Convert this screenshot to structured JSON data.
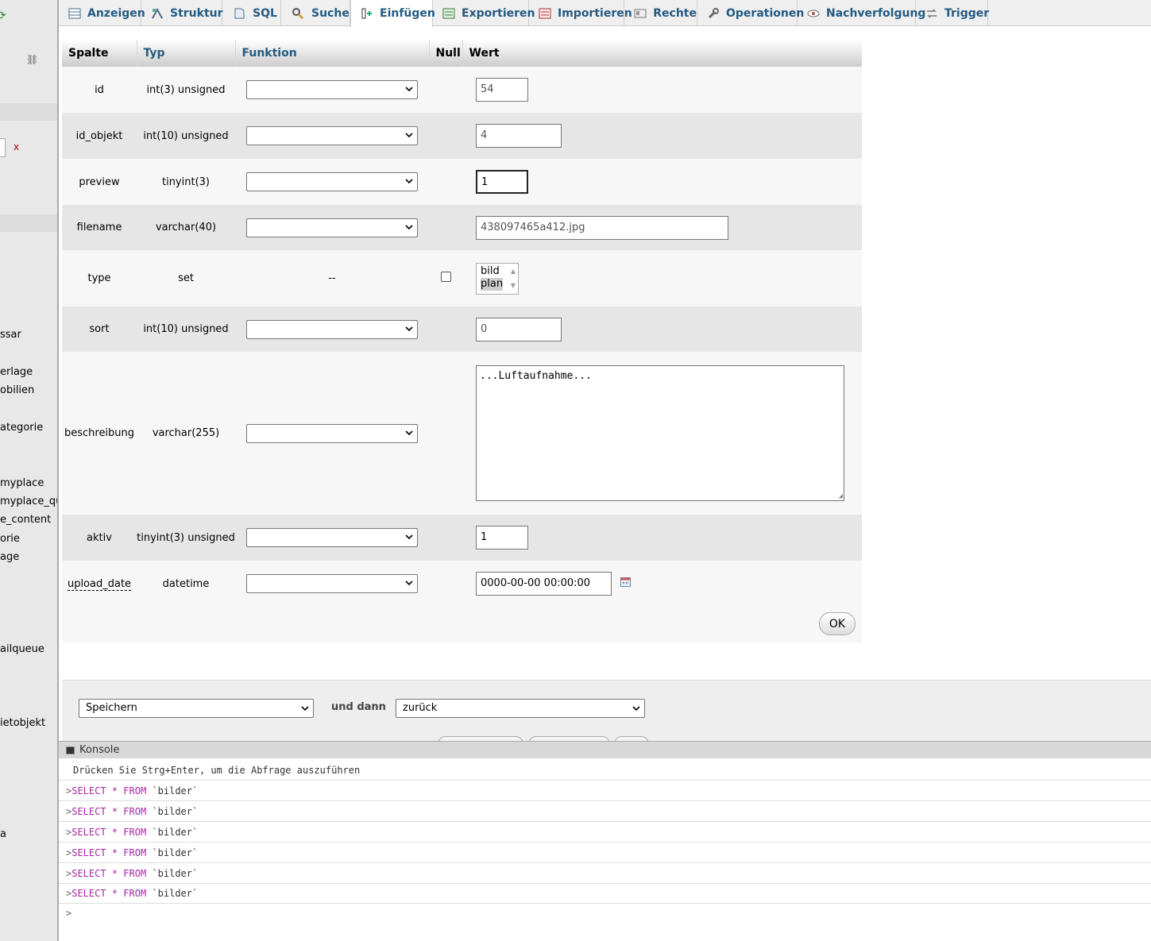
{
  "sidebar": {
    "items": [
      "ssar",
      "erlage",
      "obilien",
      "ategorie",
      "myplace",
      "myplace_que",
      "e_content",
      "orie",
      "age",
      "ailqueue",
      "ietobjekt",
      "a"
    ],
    "search_clear": "x"
  },
  "tabs": [
    {
      "label": "Anzeigen",
      "icon": "table-browse-icon"
    },
    {
      "label": "Struktur",
      "icon": "structure-icon"
    },
    {
      "label": "SQL",
      "icon": "sql-icon"
    },
    {
      "label": "Suche",
      "icon": "search-icon"
    },
    {
      "label": "Einfügen",
      "icon": "insert-icon",
      "active": true
    },
    {
      "label": "Exportieren",
      "icon": "export-icon"
    },
    {
      "label": "Importieren",
      "icon": "import-icon"
    },
    {
      "label": "Rechte",
      "icon": "privileges-icon"
    },
    {
      "label": "Operationen",
      "icon": "wrench-icon"
    },
    {
      "label": "Nachverfolgung",
      "icon": "eye-icon"
    },
    {
      "label": "Trigger",
      "icon": "trigger-icon"
    }
  ],
  "table": {
    "headers": {
      "column": "Spalte",
      "type": "Typ",
      "function": "Funktion",
      "null": "Null",
      "value": "Wert"
    },
    "rows": [
      {
        "column": "id",
        "type": "int(3) unsigned",
        "value": "54"
      },
      {
        "column": "id_objekt",
        "type": "int(10) unsigned",
        "value": "4"
      },
      {
        "column": "preview",
        "type": "tinyint(3)",
        "value": "1"
      },
      {
        "column": "filename",
        "type": "varchar(40)",
        "value": "438097465a412.jpg"
      },
      {
        "column": "type",
        "type": "set",
        "function_text": "--",
        "options": [
          "bild",
          "plan"
        ],
        "selected_option": "plan"
      },
      {
        "column": "sort",
        "type": "int(10) unsigned",
        "value": "0"
      },
      {
        "column": "beschreibung",
        "type": "varchar(255)",
        "value": "...Luftaufnahme..."
      },
      {
        "column": "aktiv",
        "type": "tinyint(3) unsigned",
        "value": "1"
      },
      {
        "column": "upload_date",
        "type": "datetime",
        "value": "0000-00-00 00:00:00"
      }
    ]
  },
  "ok_label": "OK",
  "bottom": {
    "action_value": "Speichern",
    "and_then": "und dann",
    "then_value": "zurück"
  },
  "console": {
    "title": "Konsole",
    "hint": "Drücken Sie Strg+Enter, um die Abfrage auszuführen",
    "query_lines": [
      {
        "keyword1": "SELECT",
        "star": "*",
        "keyword2": "FROM",
        "table": "`bilder`"
      },
      {
        "keyword1": "SELECT",
        "star": "*",
        "keyword2": "FROM",
        "table": "`bilder`"
      },
      {
        "keyword1": "SELECT",
        "star": "*",
        "keyword2": "FROM",
        "table": "`bilder`"
      },
      {
        "keyword1": "SELECT",
        "star": "*",
        "keyword2": "FROM",
        "table": "`bilder`"
      },
      {
        "keyword1": "SELECT",
        "star": "*",
        "keyword2": "FROM",
        "table": "`bilder`"
      },
      {
        "keyword1": "SELECT",
        "star": "*",
        "keyword2": "FROM",
        "table": "`bilder`"
      }
    ],
    "prompt": ">"
  },
  "colors": {
    "link": "#235a81",
    "keyword": "#a626a4",
    "sidebar_bg": "#e8e8e8"
  }
}
